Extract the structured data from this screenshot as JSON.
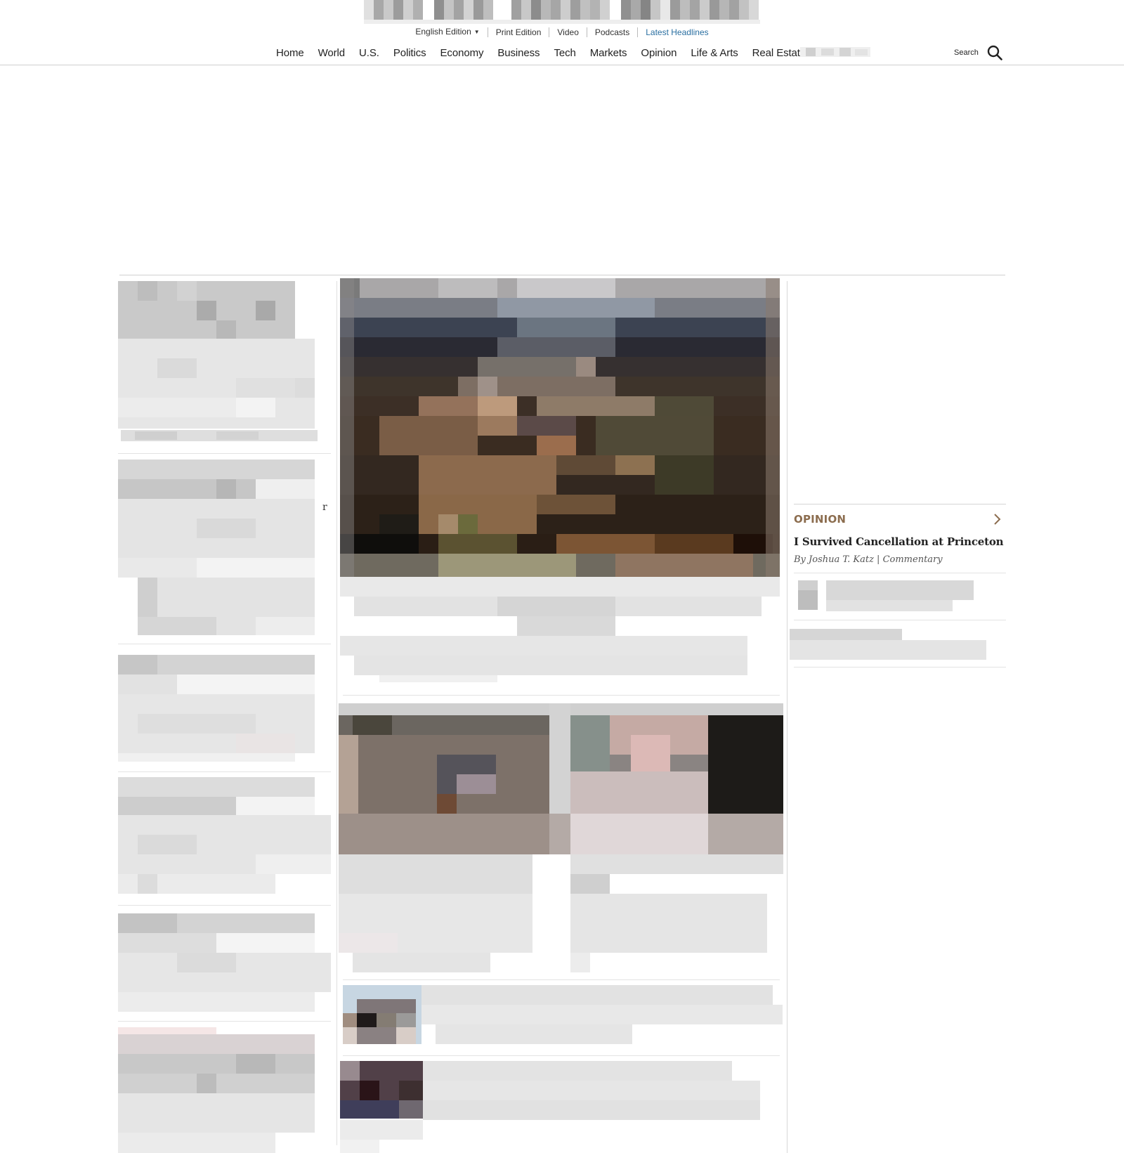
{
  "utility_bar": {
    "items": [
      {
        "label": "English Edition",
        "caret": "▼"
      },
      {
        "label": "Print Edition"
      },
      {
        "label": "Video"
      },
      {
        "label": "Podcasts"
      },
      {
        "label": "Latest Headlines"
      }
    ]
  },
  "nav": {
    "items": [
      "Home",
      "World",
      "U.S.",
      "Politics",
      "Economy",
      "Business",
      "Tech",
      "Markets",
      "Opinion",
      "Life & Arts",
      "Real Estate"
    ],
    "search_label": "Search"
  },
  "sidebar_right": {
    "opinion": {
      "label": "OPINION",
      "headline": "I Survived Cancellation at Princeton",
      "byline": "By Joshua T. Katz | Commentary"
    }
  },
  "colors": {
    "latest_link": "#2a6fa1",
    "opinion_label": "#8c6d4f"
  },
  "icons": [
    "dropdown-caret-icon",
    "search-icon",
    "chevron-right-icon"
  ]
}
